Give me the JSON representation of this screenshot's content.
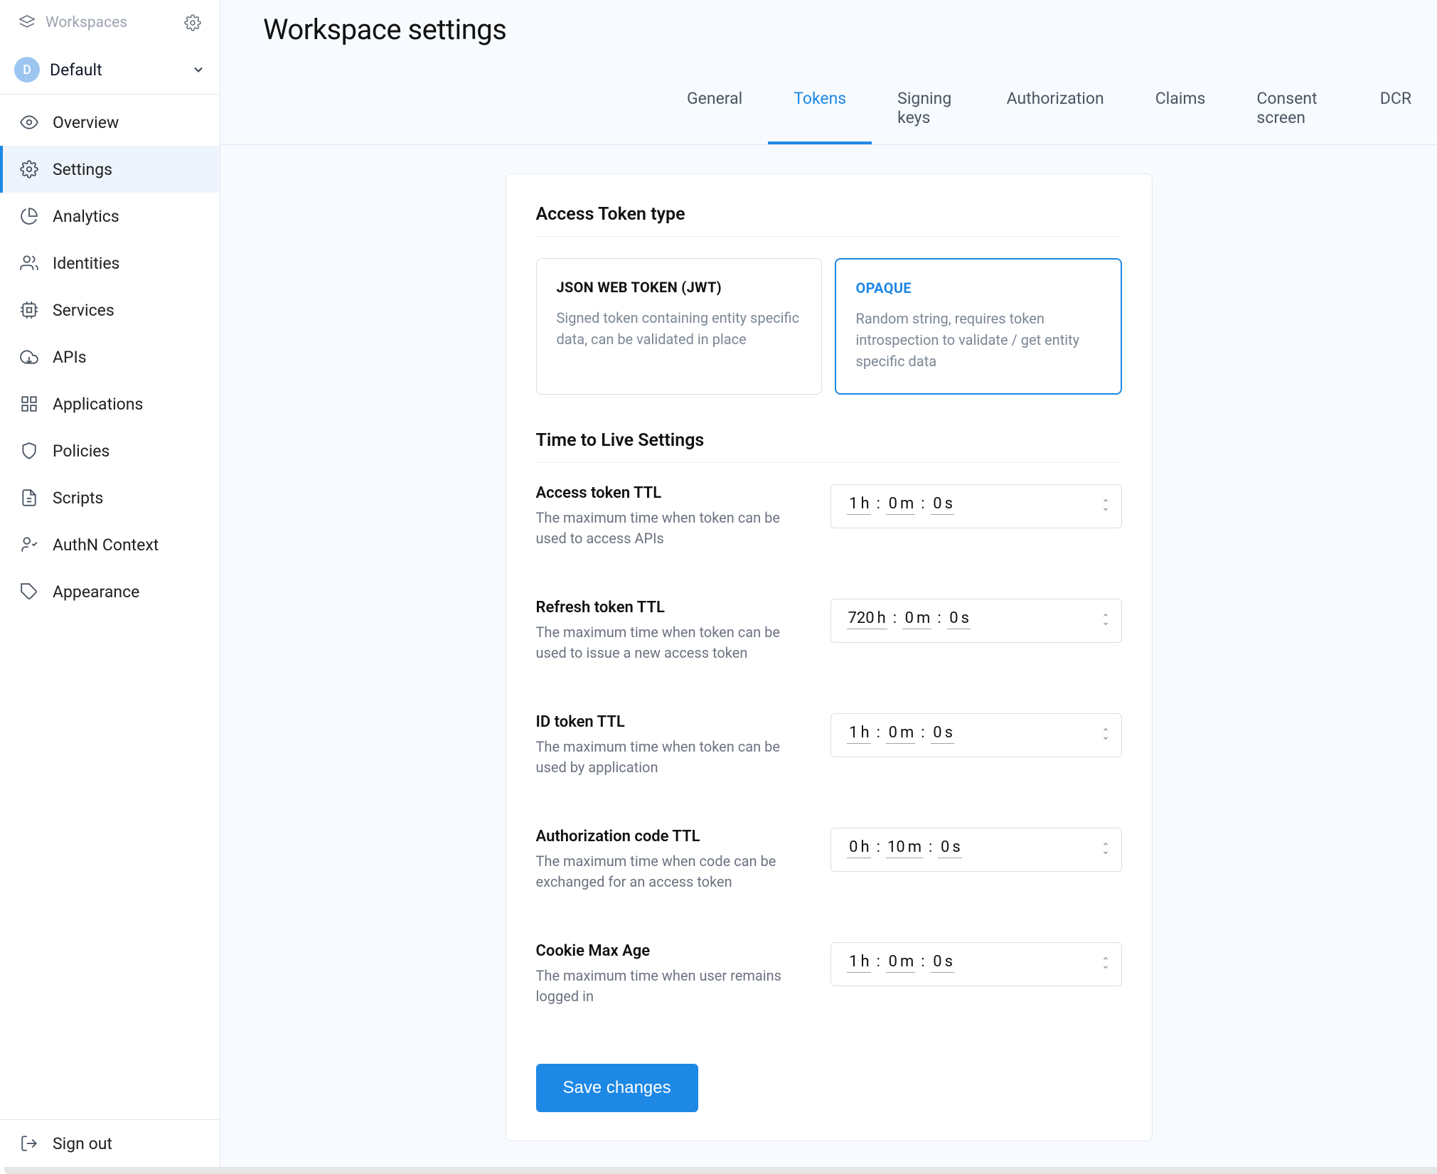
{
  "sidebar": {
    "workspaces_label": "Workspaces",
    "current_workspace_initial": "D",
    "current_workspace_name": "Default",
    "items": [
      {
        "label": "Overview",
        "icon": "eye"
      },
      {
        "label": "Settings",
        "icon": "gear",
        "active": true
      },
      {
        "label": "Analytics",
        "icon": "pie"
      },
      {
        "label": "Identities",
        "icon": "users"
      },
      {
        "label": "Services",
        "icon": "chip"
      },
      {
        "label": "APIs",
        "icon": "cloud"
      },
      {
        "label": "Applications",
        "icon": "grid"
      },
      {
        "label": "Policies",
        "icon": "shield"
      },
      {
        "label": "Scripts",
        "icon": "file"
      },
      {
        "label": "AuthN Context",
        "icon": "authn"
      },
      {
        "label": "Appearance",
        "icon": "tag"
      }
    ],
    "signout_label": "Sign out"
  },
  "page": {
    "title": "Workspace settings"
  },
  "tabs": [
    {
      "label": "General"
    },
    {
      "label": "Tokens",
      "active": true
    },
    {
      "label": "Signing keys"
    },
    {
      "label": "Authorization"
    },
    {
      "label": "Claims"
    },
    {
      "label": "Consent screen"
    },
    {
      "label": "DCR"
    }
  ],
  "sections": {
    "access_token_type": {
      "title": "Access Token type",
      "options": [
        {
          "title": "JSON WEB TOKEN (JWT)",
          "desc": "Signed token containing entity specific data, can be validated in place"
        },
        {
          "title": "OPAQUE",
          "desc": "Random string, requires token introspection to validate / get entity specific data",
          "selected": true
        }
      ]
    },
    "ttl": {
      "title": "Time to Live Settings",
      "rows": [
        {
          "label": "Access token TTL",
          "desc": "The maximum time when token can be used to access APIs",
          "h": "1",
          "m": "0",
          "s": "0"
        },
        {
          "label": "Refresh token TTL",
          "desc": "The maximum time when token can be used to issue a new access token",
          "h": "720",
          "m": "0",
          "s": "0"
        },
        {
          "label": "ID token TTL",
          "desc": "The maximum time when token can be used by application",
          "h": "1",
          "m": "0",
          "s": "0"
        },
        {
          "label": "Authorization code TTL",
          "desc": "The maximum time when code can be exchanged for an access token",
          "h": "0",
          "m": "10",
          "s": "0"
        },
        {
          "label": "Cookie Max Age",
          "desc": "The maximum time when user remains logged in",
          "h": "1",
          "m": "0",
          "s": "0"
        }
      ]
    }
  },
  "actions": {
    "save": "Save changes"
  }
}
